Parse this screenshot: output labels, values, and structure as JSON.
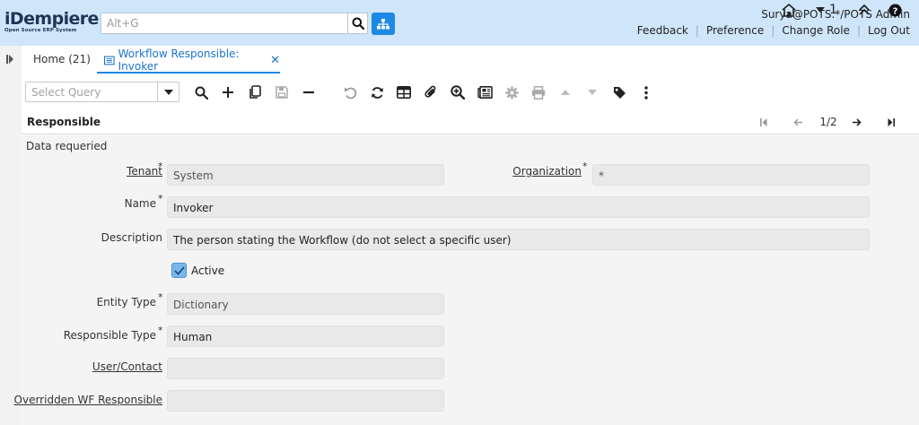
{
  "header": {
    "logo_text": "iDempiere",
    "logo_subtitle": "Open Source ERP System",
    "search_placeholder": "Alt+G",
    "user": "Surya@POTS.*/POTS Admin",
    "links": [
      "Feedback",
      "Preference",
      "Change Role",
      "Log Out"
    ]
  },
  "tabs": {
    "home": "Home (21)",
    "active": "Workflow Responsible: Invoker",
    "window_count": "1"
  },
  "toolbar": {
    "query_placeholder": "Select Query"
  },
  "section": {
    "title": "Responsible",
    "record_position": "1/2"
  },
  "form": {
    "message": "Data requeried",
    "tenant_label": "Tenant",
    "tenant_value": "System",
    "organization_label": "Organization",
    "organization_value": "*",
    "name_label": "Name",
    "name_value": "Invoker",
    "description_label": "Description",
    "description_value": "The person stating the Workflow (do not select a specific user)",
    "active_label": "Active",
    "active_checked": true,
    "entity_type_label": "Entity Type",
    "entity_type_value": "Dictionary",
    "responsible_type_label": "Responsible Type",
    "responsible_type_value": "Human",
    "user_contact_label": "User/Contact",
    "user_contact_value": "",
    "overridden_label": "Overridden WF Responsible",
    "overridden_value": "",
    "required_marker": "*"
  },
  "colors": {
    "header_bg": "#cfe6fa",
    "accent": "#1e88e5",
    "field_bg": "#e9e9e9",
    "form_bg": "#f4f4f4"
  }
}
